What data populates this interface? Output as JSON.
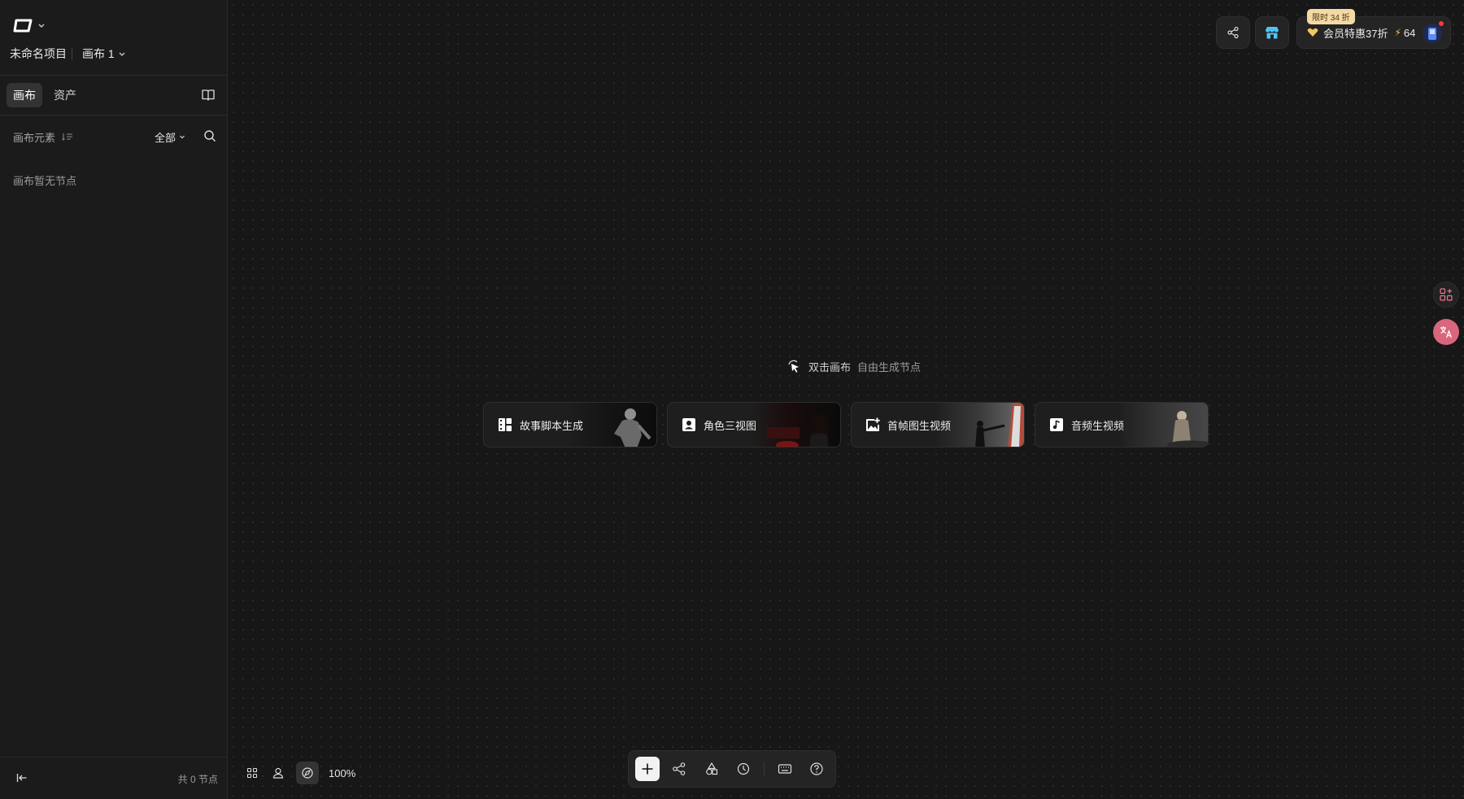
{
  "project": {
    "name": "未命名项目",
    "canvas_name": "画布 1"
  },
  "tabs": [
    {
      "label": "画布",
      "active": true
    },
    {
      "label": "资产",
      "active": false
    }
  ],
  "elements": {
    "title": "画布元素",
    "filter_value": "全部",
    "empty_message": "画布暂无节点"
  },
  "footer": {
    "node_count": "共 0 节点"
  },
  "member": {
    "badge": "限时 34 折",
    "label": "会员特惠37折",
    "credits": "64"
  },
  "canvas": {
    "hint": "双击画布",
    "hint_sub": "自由生成节点",
    "zoom": "100%",
    "quick_cards": [
      {
        "label": "故事脚本生成",
        "icon": "storyboard-icon"
      },
      {
        "label": "角色三视图",
        "icon": "portrait-icon"
      },
      {
        "label": "首帧图生视频",
        "icon": "image-add-icon"
      },
      {
        "label": "音频生视频",
        "icon": "music-note-icon"
      }
    ]
  },
  "colors": {
    "background": "#171717",
    "sidebar": "#1b1b1b",
    "badge": "#f3d9a3",
    "accent": "#4fc3f7",
    "notify": "#ff3b3b"
  }
}
